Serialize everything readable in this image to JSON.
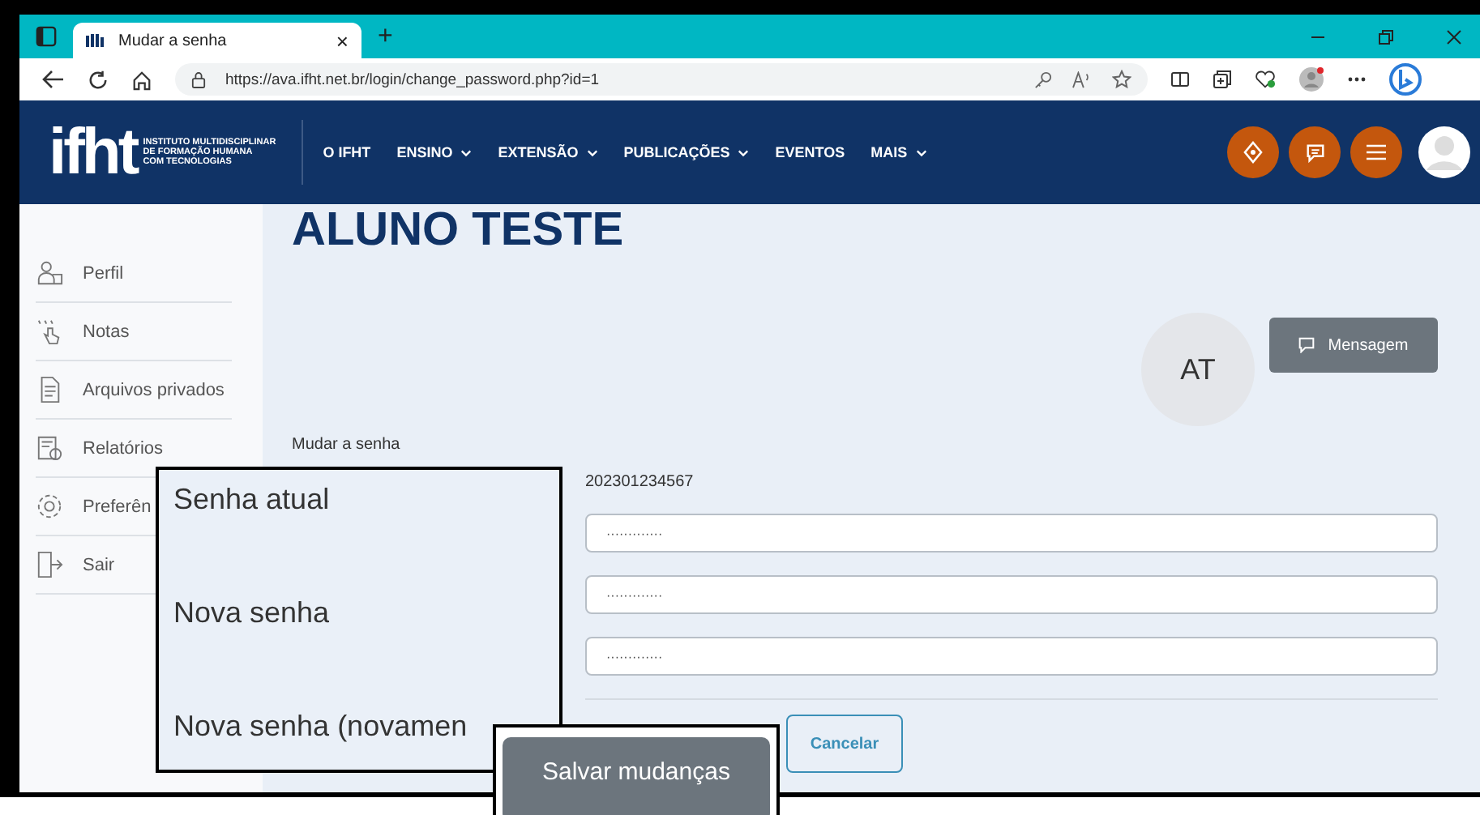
{
  "browser": {
    "tab_title": "Mudar a senha",
    "tab_close": "×",
    "new_tab": "+",
    "url": "https://ava.ifht.net.br/login/change_password.php?id=1"
  },
  "site_header": {
    "logo": "ifht",
    "logo_caption": [
      "INSTITUTO MULTIDISCIPLINAR",
      "DE FORMAÇÃO HUMANA",
      "COM TECNOLOGIAS"
    ],
    "nav": [
      {
        "label": "O IFHT",
        "dropdown": false
      },
      {
        "label": "ENSINO",
        "dropdown": true
      },
      {
        "label": "EXTENSÃO",
        "dropdown": true
      },
      {
        "label": "PUBLICAÇÕES",
        "dropdown": true
      },
      {
        "label": "EVENTOS",
        "dropdown": false
      },
      {
        "label": "MAIS",
        "dropdown": true
      }
    ]
  },
  "sidebar": {
    "items": [
      "Perfil",
      "Notas",
      "Arquivos privados",
      "Relatórios",
      "Preferên",
      "Sair"
    ]
  },
  "profile": {
    "name": "ALUNO TESTE",
    "initials": "AT",
    "message_button": "Mensagem"
  },
  "form": {
    "title": "Mudar a senha",
    "username": "202301234567",
    "fields": [
      {
        "value": "·············"
      },
      {
        "value": "·············"
      },
      {
        "value": "·············"
      }
    ],
    "cancel_button": "Cancelar"
  },
  "callouts": {
    "labels": [
      "Senha atual",
      "Nova senha",
      "Nova senha (novamen"
    ],
    "save_button": "Salvar mudanças"
  }
}
